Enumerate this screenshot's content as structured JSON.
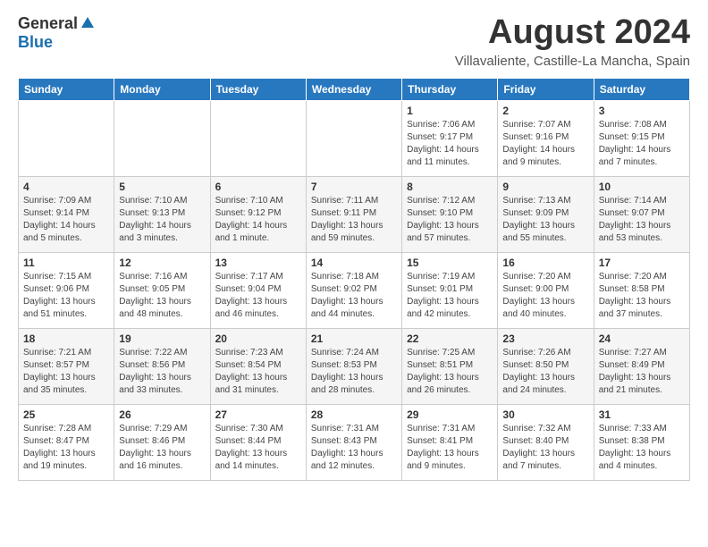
{
  "header": {
    "logo_general": "General",
    "logo_blue": "Blue",
    "month_year": "August 2024",
    "location": "Villavaliente, Castille-La Mancha, Spain"
  },
  "weekdays": [
    "Sunday",
    "Monday",
    "Tuesday",
    "Wednesday",
    "Thursday",
    "Friday",
    "Saturday"
  ],
  "weeks": [
    [
      {
        "day": "",
        "info": ""
      },
      {
        "day": "",
        "info": ""
      },
      {
        "day": "",
        "info": ""
      },
      {
        "day": "",
        "info": ""
      },
      {
        "day": "1",
        "info": "Sunrise: 7:06 AM\nSunset: 9:17 PM\nDaylight: 14 hours\nand 11 minutes."
      },
      {
        "day": "2",
        "info": "Sunrise: 7:07 AM\nSunset: 9:16 PM\nDaylight: 14 hours\nand 9 minutes."
      },
      {
        "day": "3",
        "info": "Sunrise: 7:08 AM\nSunset: 9:15 PM\nDaylight: 14 hours\nand 7 minutes."
      }
    ],
    [
      {
        "day": "4",
        "info": "Sunrise: 7:09 AM\nSunset: 9:14 PM\nDaylight: 14 hours\nand 5 minutes."
      },
      {
        "day": "5",
        "info": "Sunrise: 7:10 AM\nSunset: 9:13 PM\nDaylight: 14 hours\nand 3 minutes."
      },
      {
        "day": "6",
        "info": "Sunrise: 7:10 AM\nSunset: 9:12 PM\nDaylight: 14 hours\nand 1 minute."
      },
      {
        "day": "7",
        "info": "Sunrise: 7:11 AM\nSunset: 9:11 PM\nDaylight: 13 hours\nand 59 minutes."
      },
      {
        "day": "8",
        "info": "Sunrise: 7:12 AM\nSunset: 9:10 PM\nDaylight: 13 hours\nand 57 minutes."
      },
      {
        "day": "9",
        "info": "Sunrise: 7:13 AM\nSunset: 9:09 PM\nDaylight: 13 hours\nand 55 minutes."
      },
      {
        "day": "10",
        "info": "Sunrise: 7:14 AM\nSunset: 9:07 PM\nDaylight: 13 hours\nand 53 minutes."
      }
    ],
    [
      {
        "day": "11",
        "info": "Sunrise: 7:15 AM\nSunset: 9:06 PM\nDaylight: 13 hours\nand 51 minutes."
      },
      {
        "day": "12",
        "info": "Sunrise: 7:16 AM\nSunset: 9:05 PM\nDaylight: 13 hours\nand 48 minutes."
      },
      {
        "day": "13",
        "info": "Sunrise: 7:17 AM\nSunset: 9:04 PM\nDaylight: 13 hours\nand 46 minutes."
      },
      {
        "day": "14",
        "info": "Sunrise: 7:18 AM\nSunset: 9:02 PM\nDaylight: 13 hours\nand 44 minutes."
      },
      {
        "day": "15",
        "info": "Sunrise: 7:19 AM\nSunset: 9:01 PM\nDaylight: 13 hours\nand 42 minutes."
      },
      {
        "day": "16",
        "info": "Sunrise: 7:20 AM\nSunset: 9:00 PM\nDaylight: 13 hours\nand 40 minutes."
      },
      {
        "day": "17",
        "info": "Sunrise: 7:20 AM\nSunset: 8:58 PM\nDaylight: 13 hours\nand 37 minutes."
      }
    ],
    [
      {
        "day": "18",
        "info": "Sunrise: 7:21 AM\nSunset: 8:57 PM\nDaylight: 13 hours\nand 35 minutes."
      },
      {
        "day": "19",
        "info": "Sunrise: 7:22 AM\nSunset: 8:56 PM\nDaylight: 13 hours\nand 33 minutes."
      },
      {
        "day": "20",
        "info": "Sunrise: 7:23 AM\nSunset: 8:54 PM\nDaylight: 13 hours\nand 31 minutes."
      },
      {
        "day": "21",
        "info": "Sunrise: 7:24 AM\nSunset: 8:53 PM\nDaylight: 13 hours\nand 28 minutes."
      },
      {
        "day": "22",
        "info": "Sunrise: 7:25 AM\nSunset: 8:51 PM\nDaylight: 13 hours\nand 26 minutes."
      },
      {
        "day": "23",
        "info": "Sunrise: 7:26 AM\nSunset: 8:50 PM\nDaylight: 13 hours\nand 24 minutes."
      },
      {
        "day": "24",
        "info": "Sunrise: 7:27 AM\nSunset: 8:49 PM\nDaylight: 13 hours\nand 21 minutes."
      }
    ],
    [
      {
        "day": "25",
        "info": "Sunrise: 7:28 AM\nSunset: 8:47 PM\nDaylight: 13 hours\nand 19 minutes."
      },
      {
        "day": "26",
        "info": "Sunrise: 7:29 AM\nSunset: 8:46 PM\nDaylight: 13 hours\nand 16 minutes."
      },
      {
        "day": "27",
        "info": "Sunrise: 7:30 AM\nSunset: 8:44 PM\nDaylight: 13 hours\nand 14 minutes."
      },
      {
        "day": "28",
        "info": "Sunrise: 7:31 AM\nSunset: 8:43 PM\nDaylight: 13 hours\nand 12 minutes."
      },
      {
        "day": "29",
        "info": "Sunrise: 7:31 AM\nSunset: 8:41 PM\nDaylight: 13 hours\nand 9 minutes."
      },
      {
        "day": "30",
        "info": "Sunrise: 7:32 AM\nSunset: 8:40 PM\nDaylight: 13 hours\nand 7 minutes."
      },
      {
        "day": "31",
        "info": "Sunrise: 7:33 AM\nSunset: 8:38 PM\nDaylight: 13 hours\nand 4 minutes."
      }
    ]
  ]
}
